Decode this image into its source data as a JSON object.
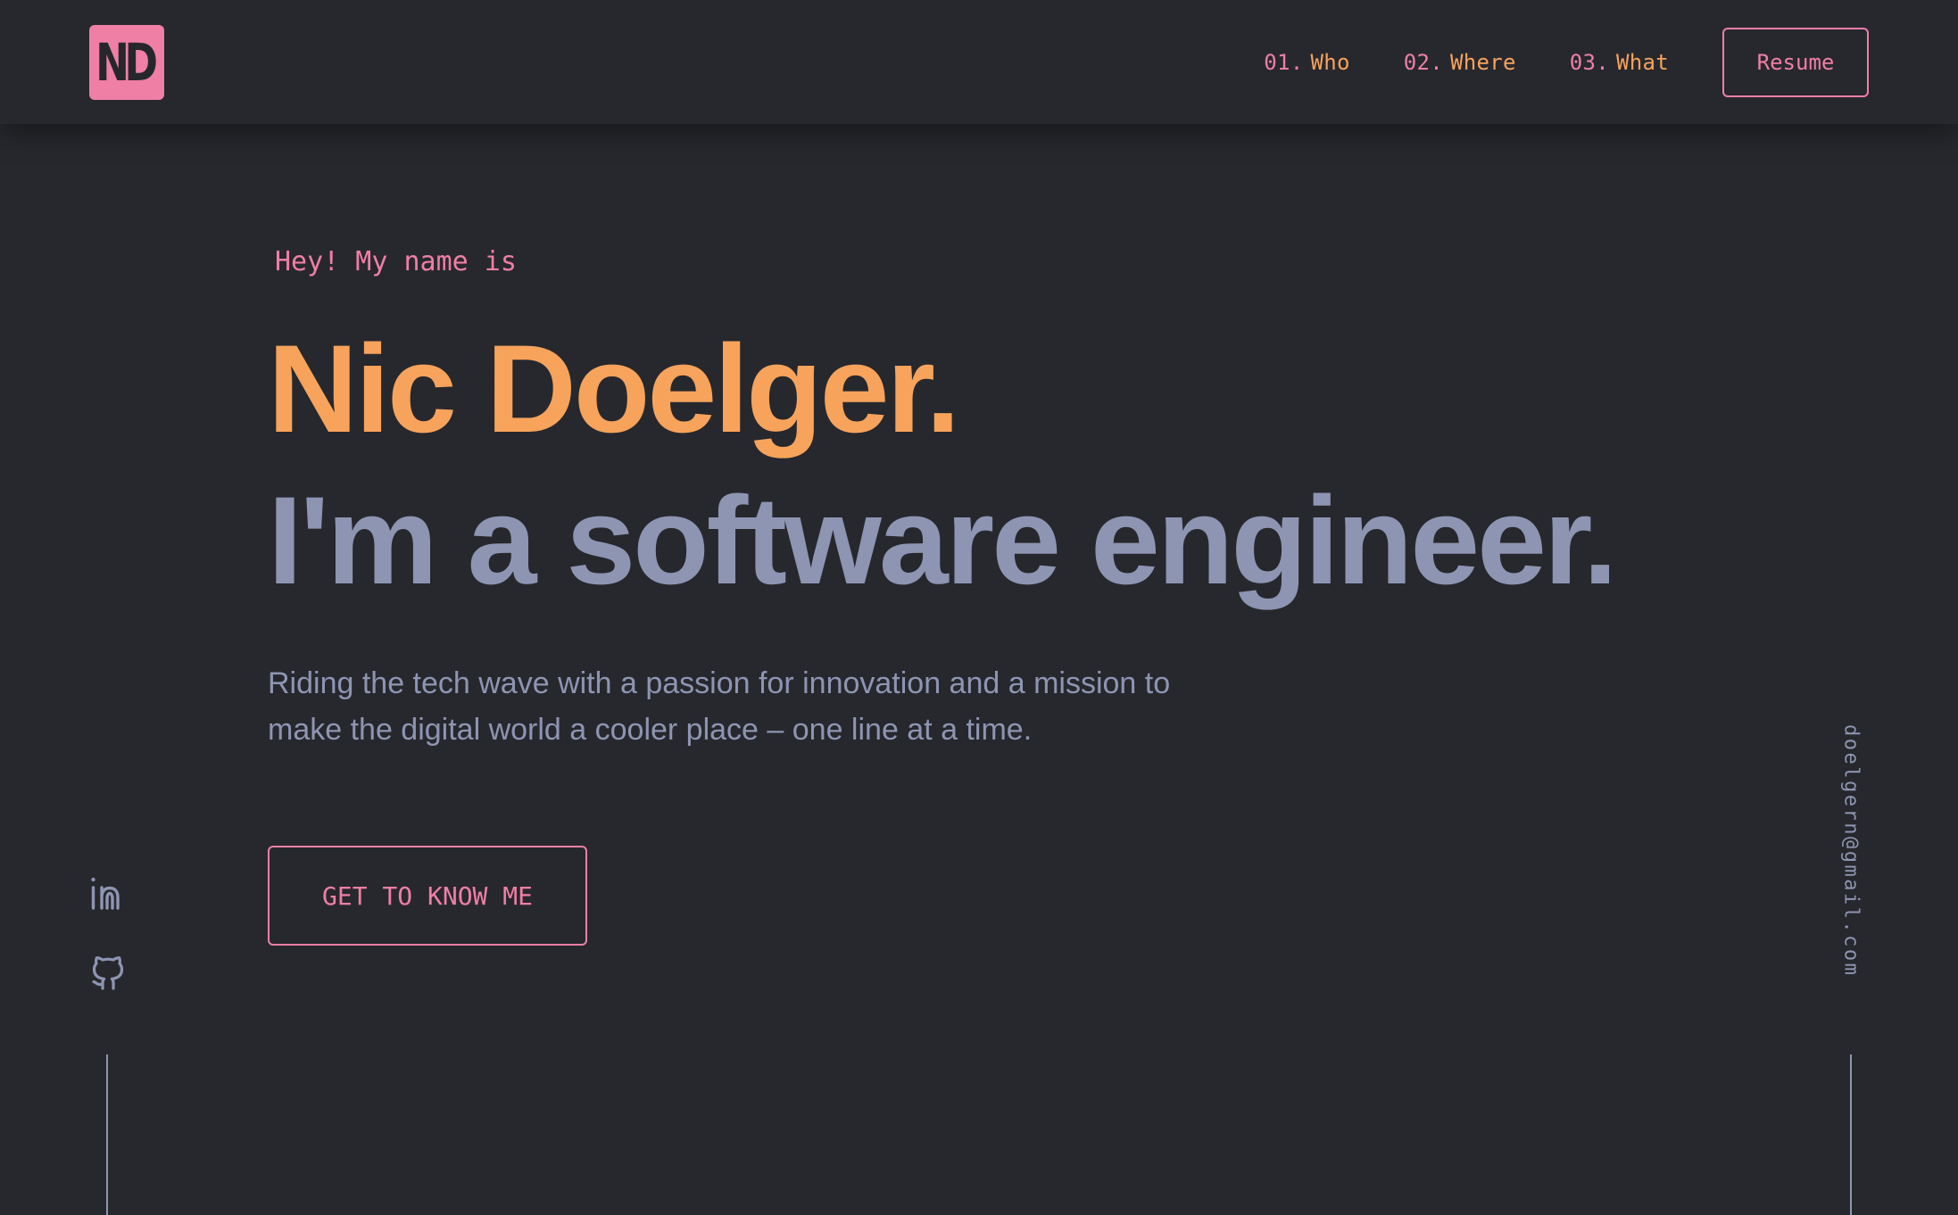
{
  "header": {
    "logo_text": "ND",
    "nav": [
      {
        "num": "01.",
        "label": "Who"
      },
      {
        "num": "02.",
        "label": "Where"
      },
      {
        "num": "03.",
        "label": "What"
      }
    ],
    "resume_label": "Resume"
  },
  "hero": {
    "intro": "Hey! My name is",
    "name": "Nic Doelger.",
    "tagline": "I'm a software engineer.",
    "description": "Riding the tech wave with a passion for innovation and a mission to make the digital world a cooler place – one line at a time.",
    "cta_label": "GET TO KNOW ME"
  },
  "social": {
    "icons": [
      "linkedin-icon",
      "github-icon"
    ]
  },
  "email": "doelgern@gmail.com",
  "colors": {
    "background": "#27282d",
    "pink": "#ef7fa4",
    "orange": "#f7a35c",
    "slate": "#8e95b3"
  }
}
